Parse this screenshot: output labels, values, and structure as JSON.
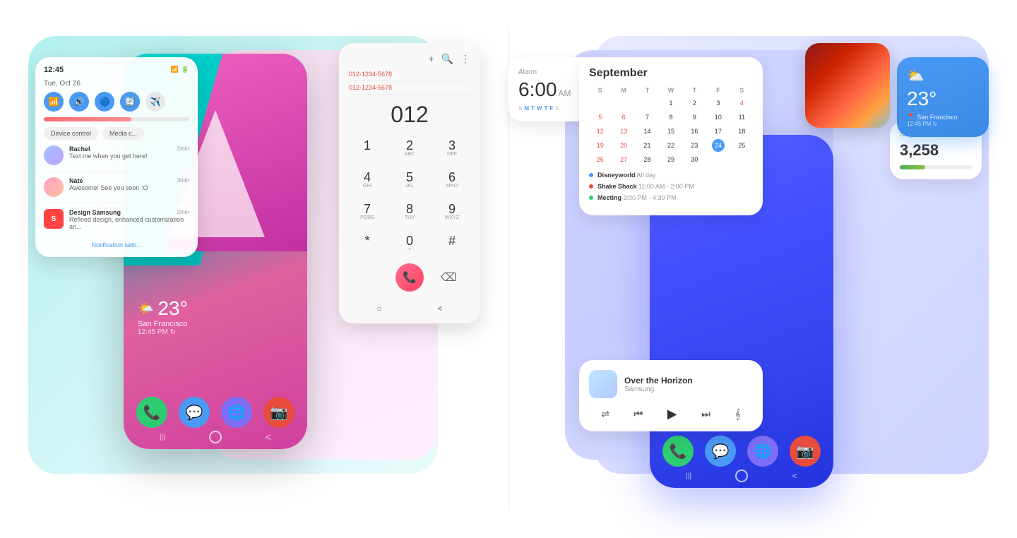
{
  "left": {
    "notif": {
      "time": "12:45",
      "date": "Tue, Oct 26",
      "toggles": [
        "wifi",
        "sound",
        "bluetooth",
        "sync",
        "airplane"
      ],
      "messages": [
        {
          "name": "Rachel",
          "age": "2min",
          "msg": "Text me when you get here!"
        },
        {
          "name": "Nate",
          "age": "3min",
          "msg": "Awesome! See you soon :O"
        },
        {
          "name": "Design Samsung",
          "age": "2min",
          "msg": "Refined design, enhanced customization an..."
        }
      ],
      "device_control": "Device control",
      "media": "Media c...",
      "settings_link": "Notification setti..."
    },
    "phone": {
      "weather_temp": "23°",
      "weather_loc": "San Francisco",
      "weather_time": "12:45 PM ↻",
      "dock": [
        "📞",
        "💬",
        "🌐",
        "📷"
      ]
    },
    "dialer": {
      "recent1": "012·1234-5678",
      "recent2": "012·1234-5678",
      "display": "012",
      "keys": [
        {
          "num": "1",
          "alpha": ""
        },
        {
          "num": "2",
          "alpha": "ABC"
        },
        {
          "num": "3",
          "alpha": "DEF"
        },
        {
          "num": "4",
          "alpha": "GHI"
        },
        {
          "num": "5",
          "alpha": "JKL"
        },
        {
          "num": "6",
          "alpha": "MNO"
        },
        {
          "num": "7",
          "alpha": "PQRS"
        },
        {
          "num": "8",
          "alpha": "TUV"
        },
        {
          "num": "9",
          "alpha": "WXYZ"
        },
        {
          "num": "*",
          "alpha": ""
        },
        {
          "num": "0",
          "alpha": "+"
        },
        {
          "num": "#",
          "alpha": ""
        }
      ]
    }
  },
  "right": {
    "calendar": {
      "month": "September",
      "days_header": [
        "S",
        "M",
        "T",
        "W",
        "T",
        "F",
        "S"
      ],
      "days": [
        "",
        "",
        "1",
        "2",
        "3",
        "4",
        "5",
        "6",
        "7",
        "8",
        "9",
        "10",
        "11",
        "12",
        "13",
        "14",
        "15",
        "16",
        "17",
        "18",
        "19",
        "20",
        "21",
        "22",
        "23",
        "24",
        "25",
        "26",
        "27",
        "28",
        "29",
        "30"
      ],
      "today": "24",
      "events": [
        {
          "title": "Disneyworld",
          "time": "All day",
          "color": "blue"
        },
        {
          "title": "Shake Shack",
          "time": "11:00 AM - 2:00 PM",
          "color": "red"
        },
        {
          "title": "Meeting",
          "time": "3:00 PM - 4:30 PM",
          "color": "green"
        }
      ]
    },
    "alarm": {
      "label": "Alarm",
      "time": "6:00",
      "ampm": "AM",
      "days": [
        "S",
        "M",
        "T",
        "W",
        "T",
        "F",
        "S"
      ],
      "active_days": [
        1,
        2,
        3,
        4,
        5
      ]
    },
    "music": {
      "title": "Over the Horizon",
      "artist": "Samsung",
      "controls": [
        "shuffle",
        "prev",
        "play",
        "next",
        "lyrics"
      ]
    },
    "steps": {
      "label": "Steps",
      "count": "3,258",
      "progress": 35
    },
    "weather": {
      "temp": "23°",
      "location": "San Francisco",
      "time": "12:45 PM ↻",
      "icon": "⛅"
    }
  }
}
